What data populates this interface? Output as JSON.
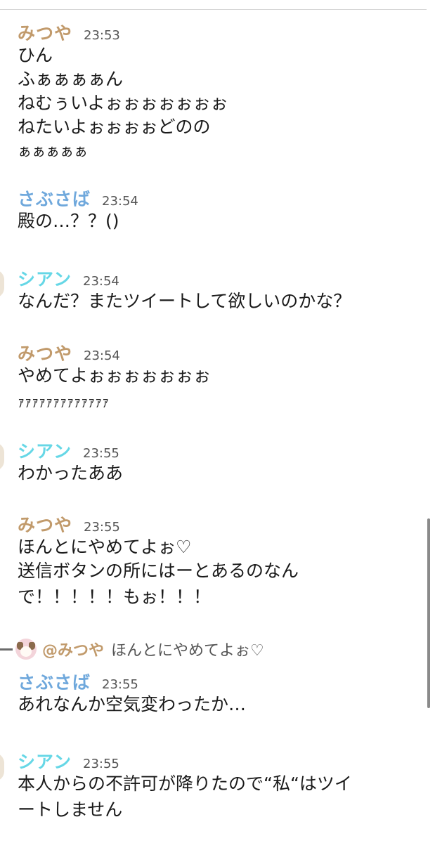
{
  "colors": {
    "mitsuya": "#c19a6b",
    "sabusaba": "#6fa8dc",
    "shian": "#66d7e6",
    "reply_mention": "#c19a6b"
  },
  "messages": [
    {
      "name": "みつや",
      "time": "23:53",
      "lines": [
        "ひん",
        "ふぁぁぁぁん",
        "ねむぅいよぉぉぉぉぉぉぉ",
        "ねたいよぉぉぉぉどのの",
        "ぁぁぁぁぁ"
      ]
    },
    {
      "name": "さぶさば",
      "time": "23:54",
      "lines": [
        "殿の…？？()"
      ]
    },
    {
      "name": "シアン",
      "time": "23:54",
      "lines": [
        "なんだ？またツイートして欲しいのかな？"
      ]
    },
    {
      "name": "みつや",
      "time": "23:54",
      "lines": [
        "やめてよぉぉぉぉぉぉぉ",
        "ｧｧｧｧｧｧｧｧｧｧｧｧｧ"
      ]
    },
    {
      "name": "シアン",
      "time": "23:55",
      "lines": [
        "わかったああ"
      ]
    },
    {
      "name": "みつや",
      "time": "23:55",
      "lines": [
        "ほんとにやめてよぉ♡",
        "送信ボタンの所にはーとあるのなん",
        "で！！！！！もぉ！！！"
      ]
    },
    {
      "name": "さぶさば",
      "time": "23:55",
      "lines": [
        "あれなんか空気変わったか…"
      ]
    },
    {
      "name": "シアン",
      "time": "23:55",
      "lines": [
        "本人からの不許可が降りたので“私“はツイ",
        "ートしません"
      ]
    }
  ],
  "reply": {
    "mention": "@みつや",
    "text": "ほんとにやめてよぉ♡",
    "avatar_icon": "dog-avatar-icon"
  }
}
